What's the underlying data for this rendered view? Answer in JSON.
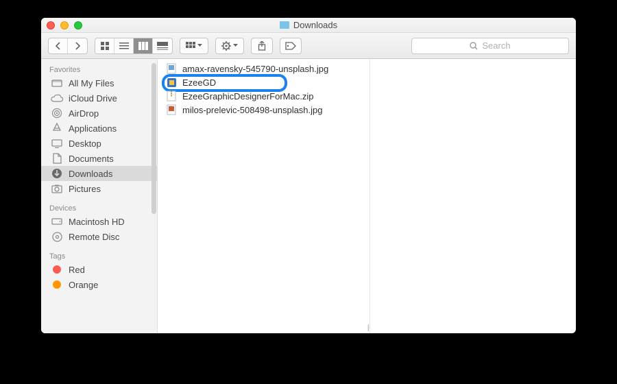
{
  "window": {
    "title": "Downloads"
  },
  "search": {
    "placeholder": "Search"
  },
  "sidebar": {
    "sections": [
      {
        "title": "Favorites",
        "items": [
          {
            "icon": "all-my-files",
            "label": "All My Files"
          },
          {
            "icon": "icloud",
            "label": "iCloud Drive"
          },
          {
            "icon": "airdrop",
            "label": "AirDrop"
          },
          {
            "icon": "applications",
            "label": "Applications"
          },
          {
            "icon": "desktop",
            "label": "Desktop"
          },
          {
            "icon": "documents",
            "label": "Documents"
          },
          {
            "icon": "downloads",
            "label": "Downloads",
            "selected": true
          },
          {
            "icon": "pictures",
            "label": "Pictures"
          }
        ]
      },
      {
        "title": "Devices",
        "items": [
          {
            "icon": "hdd",
            "label": "Macintosh HD"
          },
          {
            "icon": "remote-disc",
            "label": "Remote Disc"
          }
        ]
      },
      {
        "title": "Tags",
        "items": [
          {
            "icon": "tag-red",
            "label": "Red",
            "color": "#ff5a52"
          },
          {
            "icon": "tag-orange",
            "label": "Orange",
            "color": "#ff9500"
          }
        ]
      }
    ]
  },
  "files": [
    {
      "type": "image",
      "name": "amax-ravensky-545790-unsplash.jpg"
    },
    {
      "type": "app",
      "name": "EzeeGD",
      "highlighted": true
    },
    {
      "type": "zip",
      "name": "EzeeGraphicDesignerForMac.zip"
    },
    {
      "type": "image",
      "name": "milos-prelevic-508498-unsplash.jpg"
    }
  ]
}
